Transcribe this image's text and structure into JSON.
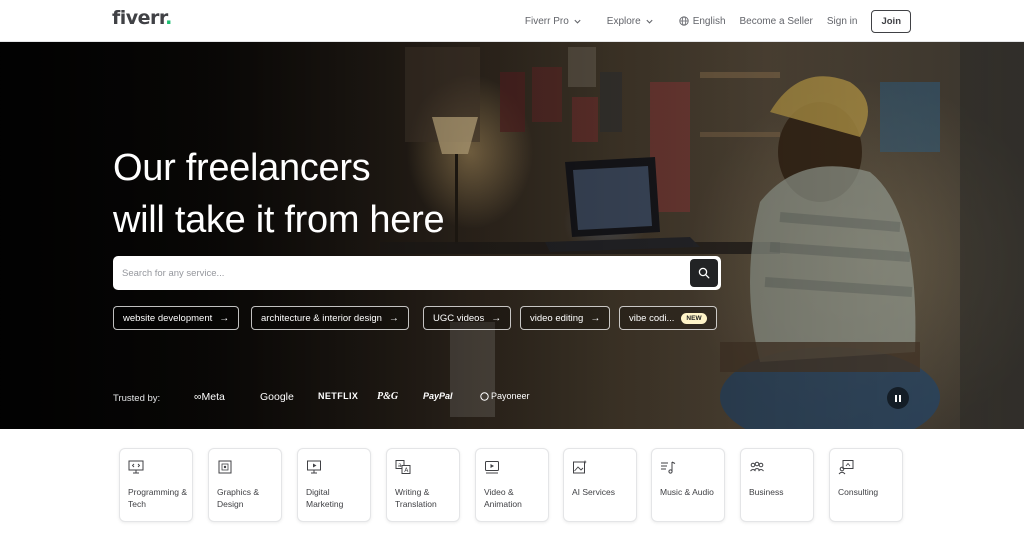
{
  "header": {
    "logo": "fiverr",
    "logo_dot": ".",
    "nav": {
      "pro": "Fiverr Pro",
      "explore": "Explore",
      "language": "English",
      "seller": "Become a Seller",
      "signin": "Sign in",
      "join": "Join"
    }
  },
  "hero": {
    "title_line1": "Our freelancers",
    "title_line2": "will take it from here",
    "search_placeholder": "Search for any service...",
    "chips": [
      {
        "label": "website development",
        "arrow": "→"
      },
      {
        "label": "architecture & interior design",
        "arrow": "→"
      },
      {
        "label": "UGC videos",
        "arrow": "→"
      },
      {
        "label": "video editing",
        "arrow": "→"
      },
      {
        "label": "vibe codi...",
        "badge": "NEW"
      }
    ],
    "trusted_label": "Trusted by:",
    "brands": [
      "∞Meta",
      "Google",
      "NETFLIX",
      "P&G",
      "PayPal",
      "Payoneer"
    ]
  },
  "categories": [
    {
      "label": "Programming & Tech",
      "icon": "monitor-code-icon"
    },
    {
      "label": "Graphics & Design",
      "icon": "design-canvas-icon"
    },
    {
      "label": "Digital Marketing",
      "icon": "marketing-screen-icon"
    },
    {
      "label": "Writing & Translation",
      "icon": "translation-icon"
    },
    {
      "label": "Video & Animation",
      "icon": "video-play-icon"
    },
    {
      "label": "AI Services",
      "icon": "ai-image-icon"
    },
    {
      "label": "Music & Audio",
      "icon": "music-note-icon"
    },
    {
      "label": "Business",
      "icon": "people-group-icon"
    },
    {
      "label": "Consulting",
      "icon": "consulting-chat-icon"
    }
  ],
  "colors": {
    "brand_green": "#1dbf73",
    "text_dark": "#404145",
    "search_button": "#222325",
    "new_badge": "#fff4c8"
  }
}
